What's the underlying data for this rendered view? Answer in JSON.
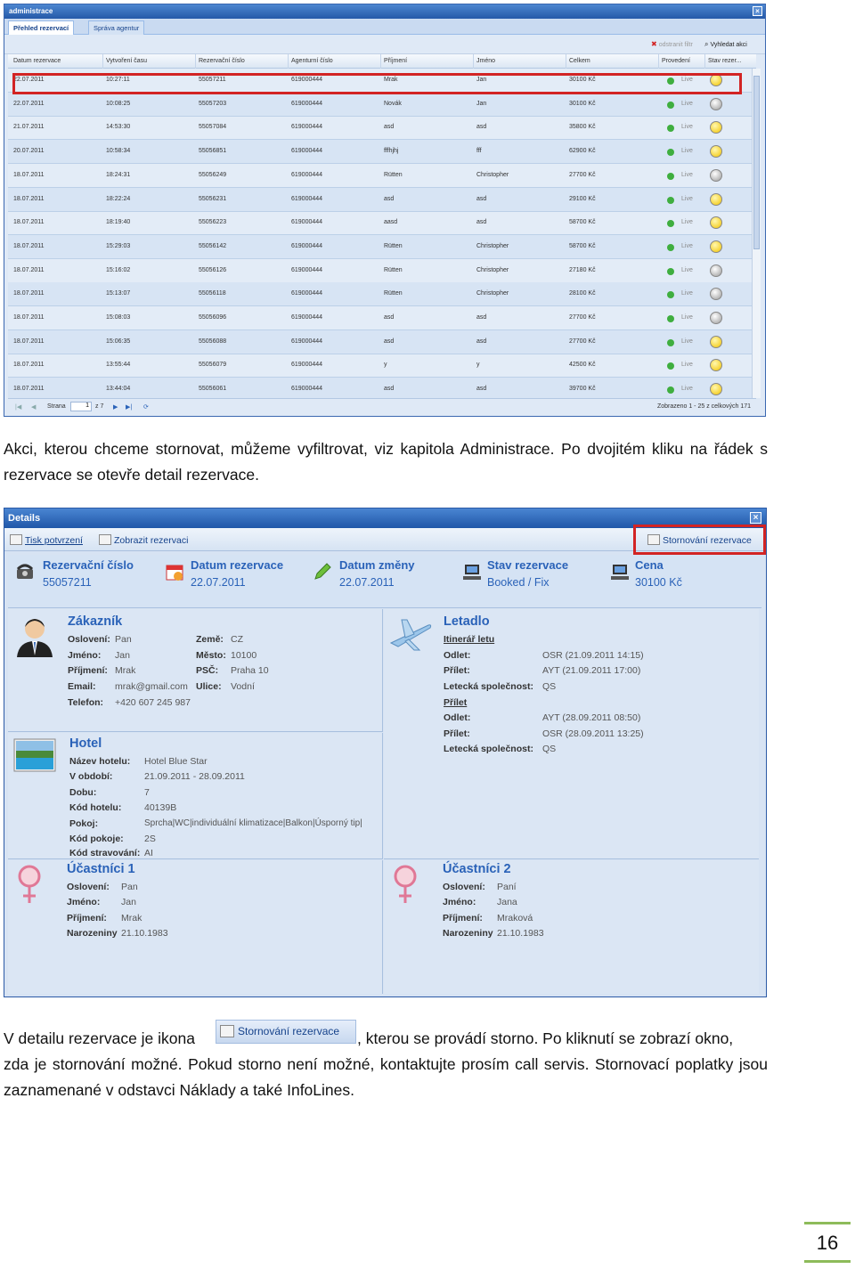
{
  "admin": {
    "title": "administrace",
    "tabs": [
      "Přehled rezervací",
      "Správa agentur"
    ],
    "toolbar": {
      "clear_filter": "odstranit filtr",
      "search_flights": "Vyhledat akci"
    },
    "columns": [
      "Datum rezervace",
      "Vytvoření času",
      "Rezervační číslo",
      "Agenturní číslo",
      "Příjmení",
      "Jméno",
      "Celkem",
      "Provedení",
      "Stav rezer..."
    ],
    "rows": [
      {
        "date": "22.07.2011",
        "time": "10:27:11",
        "res": "55057211",
        "agency": "619000444",
        "surname": "Mrak",
        "name": "Jan",
        "total": "30100 Kč",
        "status": "Live",
        "face": "y"
      },
      {
        "date": "22.07.2011",
        "time": "10:08:25",
        "res": "55057203",
        "agency": "619000444",
        "surname": "Novák",
        "name": "Jan",
        "total": "30100 Kč",
        "status": "Live",
        "face": "g"
      },
      {
        "date": "21.07.2011",
        "time": "14:53:30",
        "res": "55057084",
        "agency": "619000444",
        "surname": "asd",
        "name": "asd",
        "total": "35800 Kč",
        "status": "Live",
        "face": "y"
      },
      {
        "date": "20.07.2011",
        "time": "10:58:34",
        "res": "55056851",
        "agency": "619000444",
        "surname": "fffhjhj",
        "name": "fff",
        "total": "62900 Kč",
        "status": "Live",
        "face": "y"
      },
      {
        "date": "18.07.2011",
        "time": "18:24:31",
        "res": "55056249",
        "agency": "619000444",
        "surname": "Rütten",
        "name": "Christopher",
        "total": "27700 Kč",
        "status": "Live",
        "face": "g"
      },
      {
        "date": "18.07.2011",
        "time": "18:22:24",
        "res": "55056231",
        "agency": "619000444",
        "surname": "asd",
        "name": "asd",
        "total": "29100 Kč",
        "status": "Live",
        "face": "y"
      },
      {
        "date": "18.07.2011",
        "time": "18:19:40",
        "res": "55056223",
        "agency": "619000444",
        "surname": "aasd",
        "name": "asd",
        "total": "58700 Kč",
        "status": "Live",
        "face": "y"
      },
      {
        "date": "18.07.2011",
        "time": "15:29:03",
        "res": "55056142",
        "agency": "619000444",
        "surname": "Rütten",
        "name": "Christopher",
        "total": "58700 Kč",
        "status": "Live",
        "face": "y"
      },
      {
        "date": "18.07.2011",
        "time": "15:16:02",
        "res": "55056126",
        "agency": "619000444",
        "surname": "Rütten",
        "name": "Christopher",
        "total": "27180 Kč",
        "status": "Live",
        "face": "g"
      },
      {
        "date": "18.07.2011",
        "time": "15:13:07",
        "res": "55056118",
        "agency": "619000444",
        "surname": "Rütten",
        "name": "Christopher",
        "total": "28100 Kč",
        "status": "Live",
        "face": "g"
      },
      {
        "date": "18.07.2011",
        "time": "15:08:03",
        "res": "55056096",
        "agency": "619000444",
        "surname": "asd",
        "name": "asd",
        "total": "27700 Kč",
        "status": "Live",
        "face": "g"
      },
      {
        "date": "18.07.2011",
        "time": "15:06:35",
        "res": "55056088",
        "agency": "619000444",
        "surname": "asd",
        "name": "asd",
        "total": "27700 Kč",
        "status": "Live",
        "face": "y"
      },
      {
        "date": "18.07.2011",
        "time": "13:55:44",
        "res": "55056079",
        "agency": "619000444",
        "surname": "y",
        "name": "y",
        "total": "42500 Kč",
        "status": "Live",
        "face": "y"
      },
      {
        "date": "18.07.2011",
        "time": "13:44:04",
        "res": "55056061",
        "agency": "619000444",
        "surname": "asd",
        "name": "asd",
        "total": "39700 Kč",
        "status": "Live",
        "face": "y"
      }
    ],
    "pager": {
      "label": "Strana",
      "page": "1",
      "of": "z 7",
      "summary": "Zobrazeno 1 - 25 z celkových 171"
    }
  },
  "para1": "Akci, kterou chceme stornovat, můžeme vyfiltrovat, viz kapitola Administrace. Po dvojitém kliku na řádek s rezervace se otevře detail rezervace.",
  "details": {
    "title": "Details",
    "toolbar": {
      "print": "Tisk potvrzení",
      "show": "Zobrazit rezervaci",
      "cancel": "Stornování rezervace"
    },
    "summary": {
      "res_label": "Rezervační číslo",
      "res_value": "55057211",
      "date_label": "Datum rezervace",
      "date_value": "22.07.2011",
      "change_label": "Datum změny",
      "change_value": "22.07.2011",
      "state_label": "Stav rezervace",
      "state_value": "Booked / Fix",
      "price_label": "Cena",
      "price_value": "30100 Kč"
    },
    "customer": {
      "title": "Zákazník",
      "salutation_l": "Oslovení:",
      "salutation_v": "Pan",
      "name_l": "Jméno:",
      "name_v": "Jan",
      "surname_l": "Příjmení:",
      "surname_v": "Mrak",
      "email_l": "Email:",
      "email_v": "mrak@gmail.com",
      "phone_l": "Telefon:",
      "phone_v": "+420 607 245 987",
      "country_l": "Země:",
      "country_v": "CZ",
      "city_l": "Město:",
      "city_v": "10100",
      "zip_l": "PSČ:",
      "zip_v": "Praha 10",
      "street_l": "Ulice:",
      "street_v": "Vodní"
    },
    "flight": {
      "title": "Letadlo",
      "itinerary": "Itinerář letu",
      "dep_l": "Odlet:",
      "dep_v": "OSR (21.09.2011 14:15)",
      "arr_l": "Přílet:",
      "arr_v": "AYT (21.09.2011 17:00)",
      "airline_l": "Letecká společnost:",
      "airline_v": "QS",
      "return": "Přílet",
      "dep2_l": "Odlet:",
      "dep2_v": "AYT (28.09.2011 08:50)",
      "arr2_l": "Přílet:",
      "arr2_v": "OSR (28.09.2011 13:25)",
      "airline2_l": "Letecká společnost:",
      "airline2_v": "QS"
    },
    "hotel": {
      "title": "Hotel",
      "name_l": "Název hotelu:",
      "name_v": "Hotel Blue Star",
      "period_l": "V období:",
      "period_v": "21.09.2011 - 28.09.2011",
      "length_l": "Dobu:",
      "length_v": "7",
      "code_l": "Kód hotelu:",
      "code_v": "40139B",
      "room_l": "Pokoj:",
      "room_v": "Sprcha|WC|individuální klimatizace|Balkon|Úsporný tip|",
      "roomcode_l": "Kód pokoje:",
      "roomcode_v": "2S",
      "board_l": "Kód stravování:",
      "board_v": "AI"
    },
    "p1": {
      "title": "Účastníci 1",
      "salutation_l": "Oslovení:",
      "salutation_v": "Pan",
      "name_l": "Jméno:",
      "name_v": "Jan",
      "surname_l": "Příjmení:",
      "surname_v": "Mrak",
      "birth_l": "Narozeniny",
      "birth_v": "21.10.1983"
    },
    "p2": {
      "title": "Účastníci 2",
      "salutation_l": "Oslovení:",
      "salutation_v": "Paní",
      "name_l": "Jméno:",
      "name_v": "Jana",
      "surname_l": "Příjmení:",
      "surname_v": "Mraková",
      "birth_l": "Narozeniny",
      "birth_v": "21.10.1983"
    }
  },
  "para2": {
    "before": "V detailu rezervace je ikona",
    "button": "Stornování rezervace",
    "after_line1": ", kterou se provádí storno. Po kliknutí se zobrazí okno,",
    "rest": "zda je stornování možné. Pokud storno není možné, kontaktujte prosím call servis. Stornovací poplatky jsou zaznamenané v odstavci Náklady a také InfoLines."
  },
  "page_number": "16",
  "colors": {
    "window_blue": "#2459a8",
    "highlight_red": "#d22424",
    "status_green": "#3fae3f",
    "footer_green": "#8dbb5a"
  }
}
